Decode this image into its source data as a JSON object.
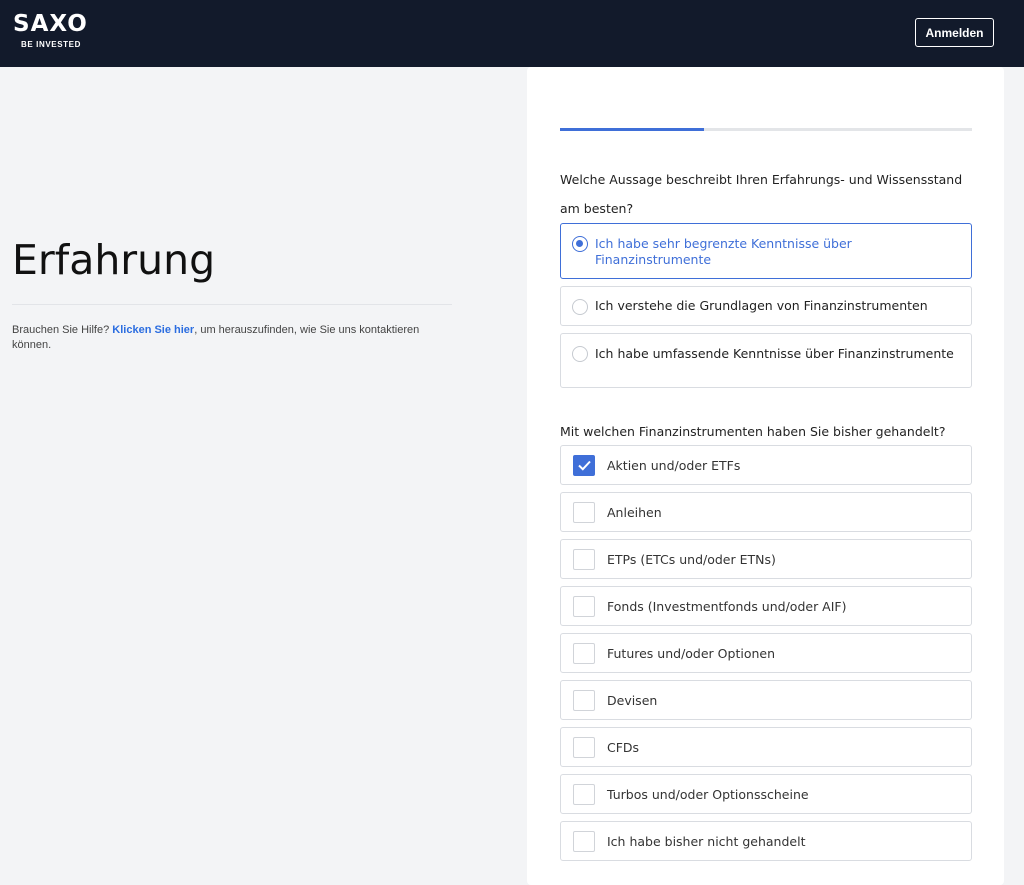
{
  "header": {
    "logo_word": "SAXO",
    "logo_tagline": "BE INVESTED",
    "login_label": "Anmelden"
  },
  "left": {
    "title": "Erfahrung",
    "help_prefix": "Brauchen Sie Hilfe? ",
    "help_link": "Klicken Sie hier",
    "help_suffix": ", um herauszufinden, wie Sie uns kontaktieren können."
  },
  "form": {
    "progress_fraction": 0.35,
    "q1": {
      "line1": "Welche Aussage beschreibt Ihren Erfahrungs- und Wissensstand",
      "line2": "am besten?",
      "options": [
        {
          "label": "Ich habe sehr begrenzte Kenntnisse über Finanzinstrumente",
          "selected": true
        },
        {
          "label": "Ich verstehe die Grundlagen von Finanzinstrumenten",
          "selected": false
        },
        {
          "label": "Ich habe umfassende Kenntnisse über Finanzinstrumente",
          "selected": false
        }
      ]
    },
    "q2": {
      "text": "Mit welchen Finanzinstrumenten haben Sie bisher gehandelt?",
      "options": [
        {
          "label": "Aktien und/oder ETFs",
          "checked": true
        },
        {
          "label": "Anleihen",
          "checked": false
        },
        {
          "label": "ETPs (ETCs und/oder ETNs)",
          "checked": false
        },
        {
          "label": "Fonds (Investmentfonds und/oder AIF)",
          "checked": false
        },
        {
          "label": "Futures und/oder Optionen",
          "checked": false
        },
        {
          "label": "Devisen",
          "checked": false
        },
        {
          "label": "CFDs",
          "checked": false
        },
        {
          "label": "Turbos und/oder Optionsscheine",
          "checked": false
        },
        {
          "label": "Ich habe bisher nicht gehandelt",
          "checked": false
        }
      ]
    }
  },
  "colors": {
    "header_bg": "#121a2b",
    "accent": "#3f6fd8",
    "page_bg": "#f3f4f6"
  }
}
